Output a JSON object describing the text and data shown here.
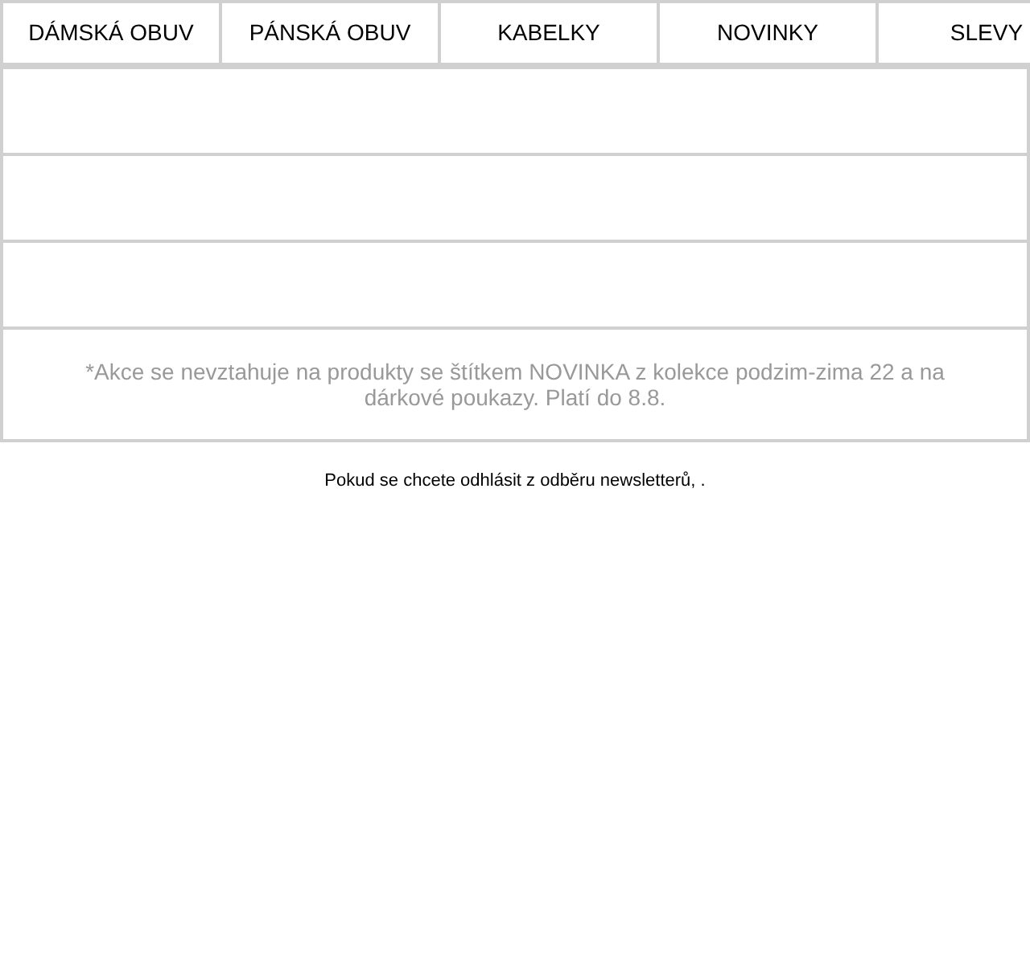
{
  "nav": [
    {
      "label": "DÁMSKÁ OBUV"
    },
    {
      "label": "PÁNSKÁ OBUV"
    },
    {
      "label": "KABELKY"
    },
    {
      "label": "NOVINKY"
    },
    {
      "label": "SLEVY"
    }
  ],
  "disclaimer": "*Akce se nevztahuje na produkty se štítkem NOVINKA z kolekce podzim-zima 22 a na dárkové poukazy. Platí do 8.8.",
  "footer": "Pokud se chcete odhlásit z odběru newsletterů, ."
}
